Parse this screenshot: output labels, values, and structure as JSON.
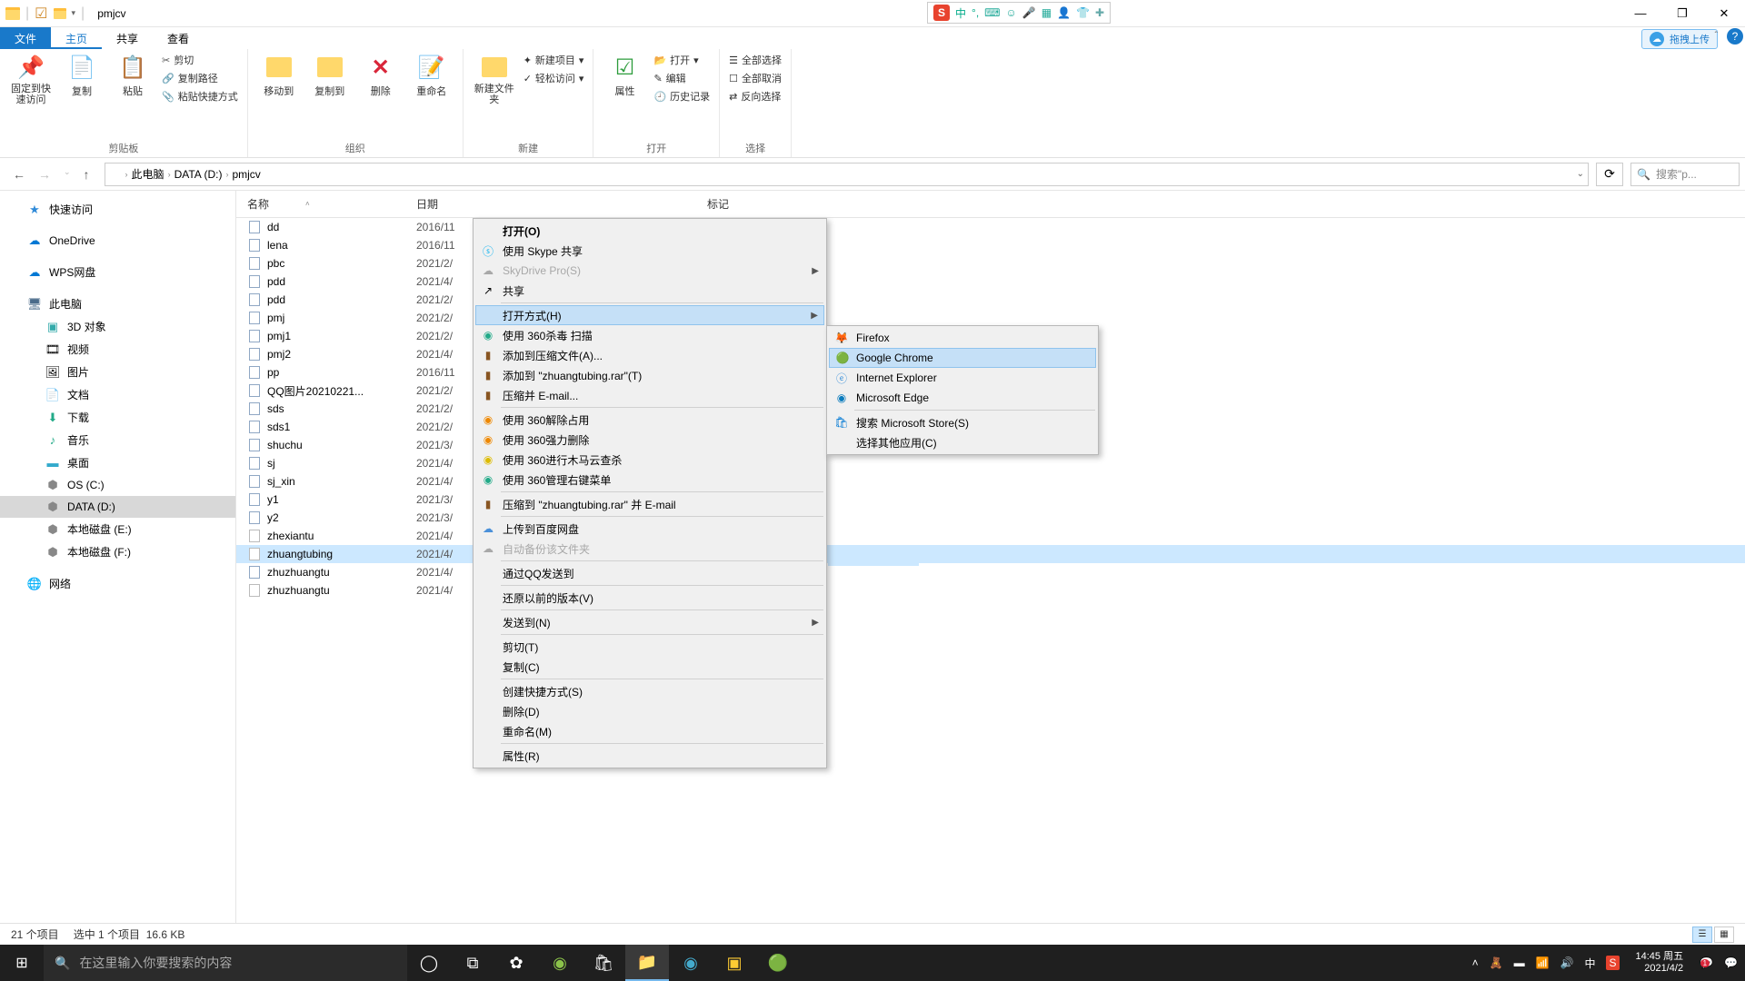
{
  "window": {
    "title": "pmjcv"
  },
  "tabs": {
    "file": "文件",
    "home": "主页",
    "share": "共享",
    "view": "查看",
    "cloud_upload": "拖拽上传"
  },
  "ribbon": {
    "clipboard": {
      "label": "剪贴板",
      "pin": "固定到快速访问",
      "copy": "复制",
      "paste": "粘贴",
      "cut": "剪切",
      "copypath": "复制路径",
      "pasteshortcut": "粘贴快捷方式"
    },
    "organize": {
      "label": "组织",
      "moveto": "移动到",
      "copyto": "复制到",
      "delete": "删除",
      "rename": "重命名"
    },
    "new": {
      "label": "新建",
      "newfolder": "新建文件夹",
      "newitem": "新建项目",
      "easyaccess": "轻松访问"
    },
    "open": {
      "label": "打开",
      "properties": "属性",
      "open": "打开",
      "edit": "编辑",
      "history": "历史记录"
    },
    "select": {
      "label": "选择",
      "all": "全部选择",
      "none": "全部取消",
      "invert": "反向选择"
    }
  },
  "breadcrumb": {
    "pc": "此电脑",
    "drive": "DATA (D:)",
    "folder": "pmjcv"
  },
  "search": {
    "placeholder": "搜索\"p..."
  },
  "nav": {
    "quick": "快速访问",
    "onedrive": "OneDrive",
    "wps": "WPS网盘",
    "pc": "此电脑",
    "obj3d": "3D 对象",
    "videos": "视频",
    "pictures": "图片",
    "documents": "文档",
    "downloads": "下载",
    "music": "音乐",
    "desktop": "桌面",
    "osc": "OS (C:)",
    "datad": "DATA (D:)",
    "locale": "本地磁盘 (E:)",
    "localf": "本地磁盘 (F:)",
    "network": "网络"
  },
  "columns": {
    "name": "名称",
    "date": "日期",
    "tags": "标记"
  },
  "files": [
    {
      "name": "dd",
      "date": "2016/11",
      "type": "doc"
    },
    {
      "name": "lena",
      "date": "2016/11",
      "type": "doc"
    },
    {
      "name": "pbc",
      "date": "2021/2/",
      "type": "doc"
    },
    {
      "name": "pdd",
      "date": "2021/4/",
      "type": "doc"
    },
    {
      "name": "pdd",
      "date": "2021/2/",
      "type": "doc"
    },
    {
      "name": "pmj",
      "date": "2021/2/",
      "type": "doc"
    },
    {
      "name": "pmj1",
      "date": "2021/2/",
      "type": "doc"
    },
    {
      "name": "pmj2",
      "date": "2021/4/",
      "type": "doc"
    },
    {
      "name": "pp",
      "date": "2016/11",
      "type": "doc"
    },
    {
      "name": "QQ图片20210221...",
      "date": "2021/2/",
      "type": "doc"
    },
    {
      "name": "sds",
      "date": "2021/2/",
      "type": "doc"
    },
    {
      "name": "sds1",
      "date": "2021/2/",
      "type": "doc"
    },
    {
      "name": "shuchu",
      "date": "2021/3/",
      "type": "doc"
    },
    {
      "name": "sj",
      "date": "2021/4/",
      "type": "doc"
    },
    {
      "name": "sj_xin",
      "date": "2021/4/",
      "type": "doc"
    },
    {
      "name": "y1",
      "date": "2021/3/",
      "type": "doc"
    },
    {
      "name": "y2",
      "date": "2021/3/",
      "type": "doc"
    },
    {
      "name": "zhexiantu",
      "date": "2021/4/",
      "type": "blank"
    },
    {
      "name": "zhuangtubing",
      "date": "2021/4/",
      "type": "blank",
      "selected": true
    },
    {
      "name": "zhuzhuangtu",
      "date": "2021/4/",
      "type": "doc"
    },
    {
      "name": "zhuzhuangtu",
      "date": "2021/4/",
      "type": "blank"
    }
  ],
  "ctx_main": {
    "open": "打开(O)",
    "skype": "使用 Skype 共享",
    "skydrive": "SkyDrive Pro(S)",
    "share": "共享",
    "openwith": "打开方式(H)",
    "scan360": "使用 360杀毒 扫描",
    "addzip": "添加到压缩文件(A)...",
    "addrar": "添加到 \"zhuangtubing.rar\"(T)",
    "zipmail": "压缩并 E-mail...",
    "unlock360": "使用 360解除占用",
    "force360": "使用 360强力删除",
    "trojan360": "使用 360进行木马云查杀",
    "menu360": "使用 360管理右键菜单",
    "zipemail": "压缩到 \"zhuangtubing.rar\" 并 E-mail",
    "baidu": "上传到百度网盘",
    "autobak": "自动备份该文件夹",
    "qqsend": "通过QQ发送到",
    "restore": "还原以前的版本(V)",
    "sendto": "发送到(N)",
    "cut": "剪切(T)",
    "copy": "复制(C)",
    "shortcut": "创建快捷方式(S)",
    "delete": "删除(D)",
    "rename": "重命名(M)",
    "props": "属性(R)"
  },
  "ctx_sub": {
    "firefox": "Firefox",
    "chrome": "Google Chrome",
    "ie": "Internet Explorer",
    "edge": "Microsoft Edge",
    "store": "搜索 Microsoft Store(S)",
    "other": "选择其他应用(C)"
  },
  "status": {
    "items": "21 个项目",
    "selected": "选中 1 个项目",
    "size": "16.6 KB"
  },
  "taskbar": {
    "search": "在这里输入你要搜索的内容",
    "time": "14:45 周五",
    "date": "2021/4/2"
  },
  "ime": {
    "zhong": "中"
  }
}
